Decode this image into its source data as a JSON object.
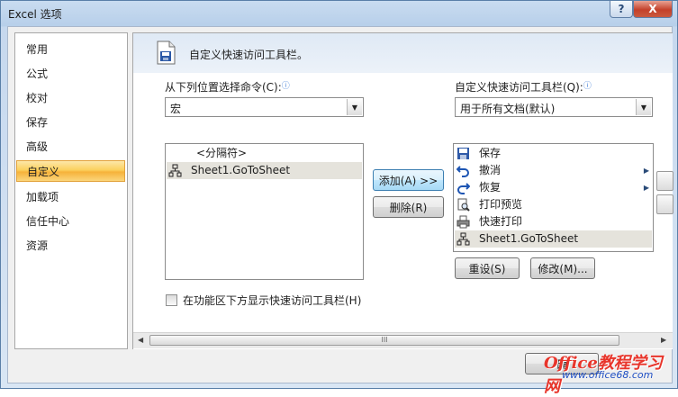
{
  "window": {
    "title": "Excel 选项",
    "help_label": "?",
    "close_label": "X"
  },
  "nav": {
    "items": [
      {
        "label": "常用"
      },
      {
        "label": "公式"
      },
      {
        "label": "校对"
      },
      {
        "label": "保存"
      },
      {
        "label": "高级"
      },
      {
        "label": "自定义"
      },
      {
        "label": "加载项"
      },
      {
        "label": "信任中心"
      },
      {
        "label": "资源"
      }
    ],
    "selected_index": 5
  },
  "header": {
    "title": "自定义快速访问工具栏。"
  },
  "left_panel": {
    "choose_label": "从下列位置选择命令(C):",
    "info_glyph": "ⓘ",
    "combo_value": "宏",
    "list": [
      {
        "label": "<分隔符>",
        "icon": "separator"
      },
      {
        "label": "Sheet1.GoToSheet",
        "icon": "macro-icon"
      }
    ]
  },
  "right_panel": {
    "customize_label": "自定义快速访问工具栏(Q):",
    "info_glyph": "ⓘ",
    "combo_value": "用于所有文档(默认)",
    "list": [
      {
        "label": "保存",
        "icon": "save-icon",
        "submenu": false
      },
      {
        "label": "撤消",
        "icon": "undo-icon",
        "submenu": true
      },
      {
        "label": "恢复",
        "icon": "redo-icon",
        "submenu": true
      },
      {
        "label": "打印预览",
        "icon": "print-preview-icon",
        "submenu": false
      },
      {
        "label": "快速打印",
        "icon": "quick-print-icon",
        "submenu": false
      },
      {
        "label": "Sheet1.GoToSheet",
        "icon": "macro-icon",
        "submenu": false
      }
    ]
  },
  "buttons": {
    "add": "添加(A) >>",
    "remove": "删除(R)",
    "reset": "重设(S)",
    "modify": "修改(M)..."
  },
  "checkbox": {
    "label": "在功能区下方显示快速访问工具栏(H)",
    "checked": false
  },
  "scrollbar": {
    "left_arrow": "◀",
    "right_arrow": "▶",
    "grip": "III"
  },
  "footer": {
    "ok_partial": "确"
  },
  "watermark": {
    "text": "Office教程学习网",
    "url": "www.office68.com"
  }
}
